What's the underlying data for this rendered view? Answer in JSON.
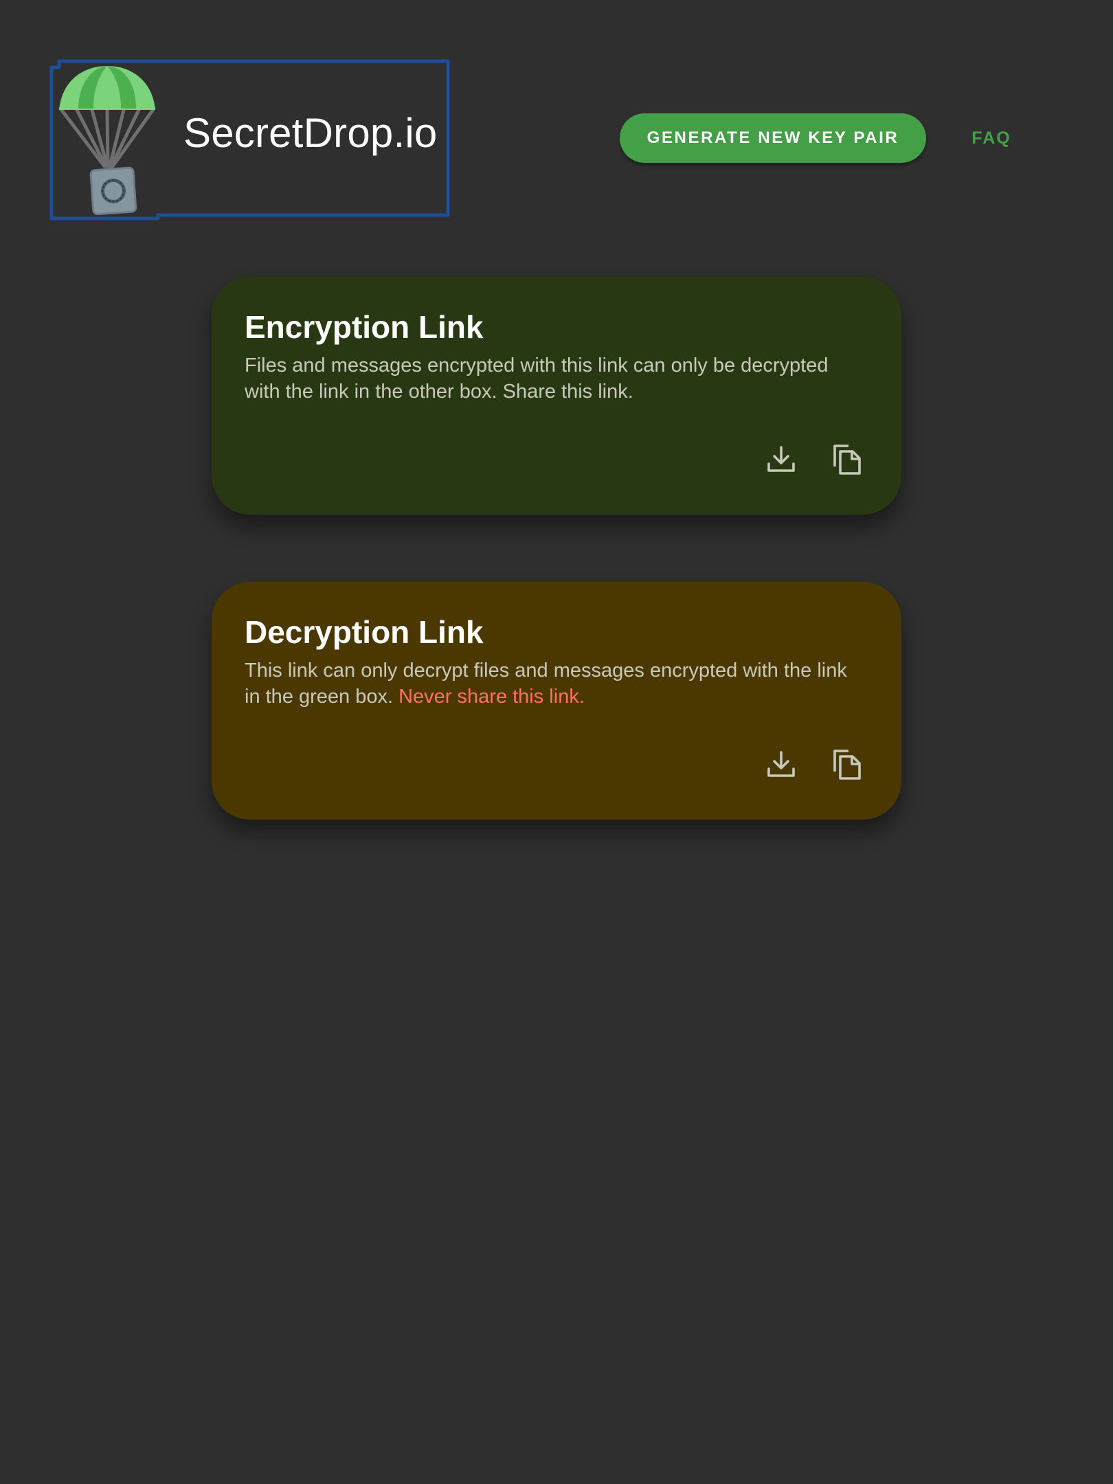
{
  "header": {
    "brand_name": "SecretDrop.io",
    "generate_label": "GENERATE NEW KEY PAIR",
    "faq_label": "FAQ"
  },
  "encryption_card": {
    "title": "Encryption Link",
    "description": "Files and messages encrypted with this link can only be decrypted with the link in the other box. Share this link.",
    "background": "#283812"
  },
  "decryption_card": {
    "title": "Decryption Link",
    "description": "This link can only decrypt files and messages encrypted with the link in the green box.",
    "warning": "Never share this link.",
    "background": "#4b3800",
    "warning_color": "#ff7063"
  },
  "icons": {
    "download": "download-icon",
    "copy": "copy-icon",
    "logo": "parachute-safe-logo-icon"
  },
  "colors": {
    "page_background": "#2f2f2f",
    "accent": "#43a047",
    "focus_outline": "#1e4e9a",
    "icon_color": "#c9c9bb"
  }
}
